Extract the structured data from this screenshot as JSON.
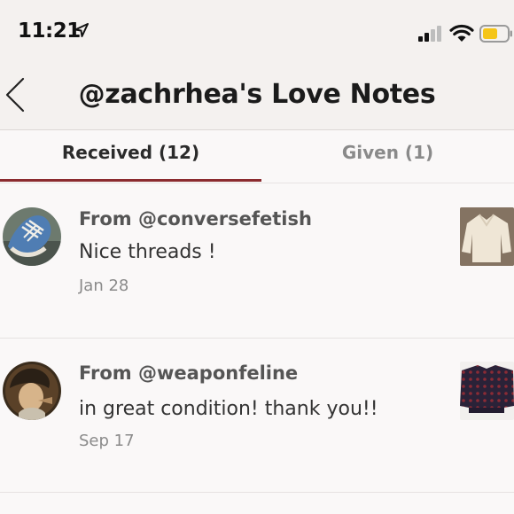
{
  "status_bar": {
    "time": "11:21"
  },
  "nav": {
    "title": "@zachrhea's Love Notes"
  },
  "tabs": [
    {
      "label": "Received (12)",
      "active": true
    },
    {
      "label": "Given (1)",
      "active": false
    }
  ],
  "notes": [
    {
      "from": "From @conversefetish",
      "message": "Nice threads !",
      "date": "Jan 28",
      "avatar": "sneaker-photo",
      "thumbnail": "cream-sweater-photo"
    },
    {
      "from": "From @weaponfeline",
      "message": "in great condition! thank you!!",
      "date": "Sep 17",
      "avatar": "painted-portrait",
      "thumbnail": "patterned-sweater-photo"
    }
  ],
  "colors": {
    "accent": "#8b2b2f",
    "header_bg": "#f4f1ef",
    "page_bg": "#faf8f8"
  }
}
